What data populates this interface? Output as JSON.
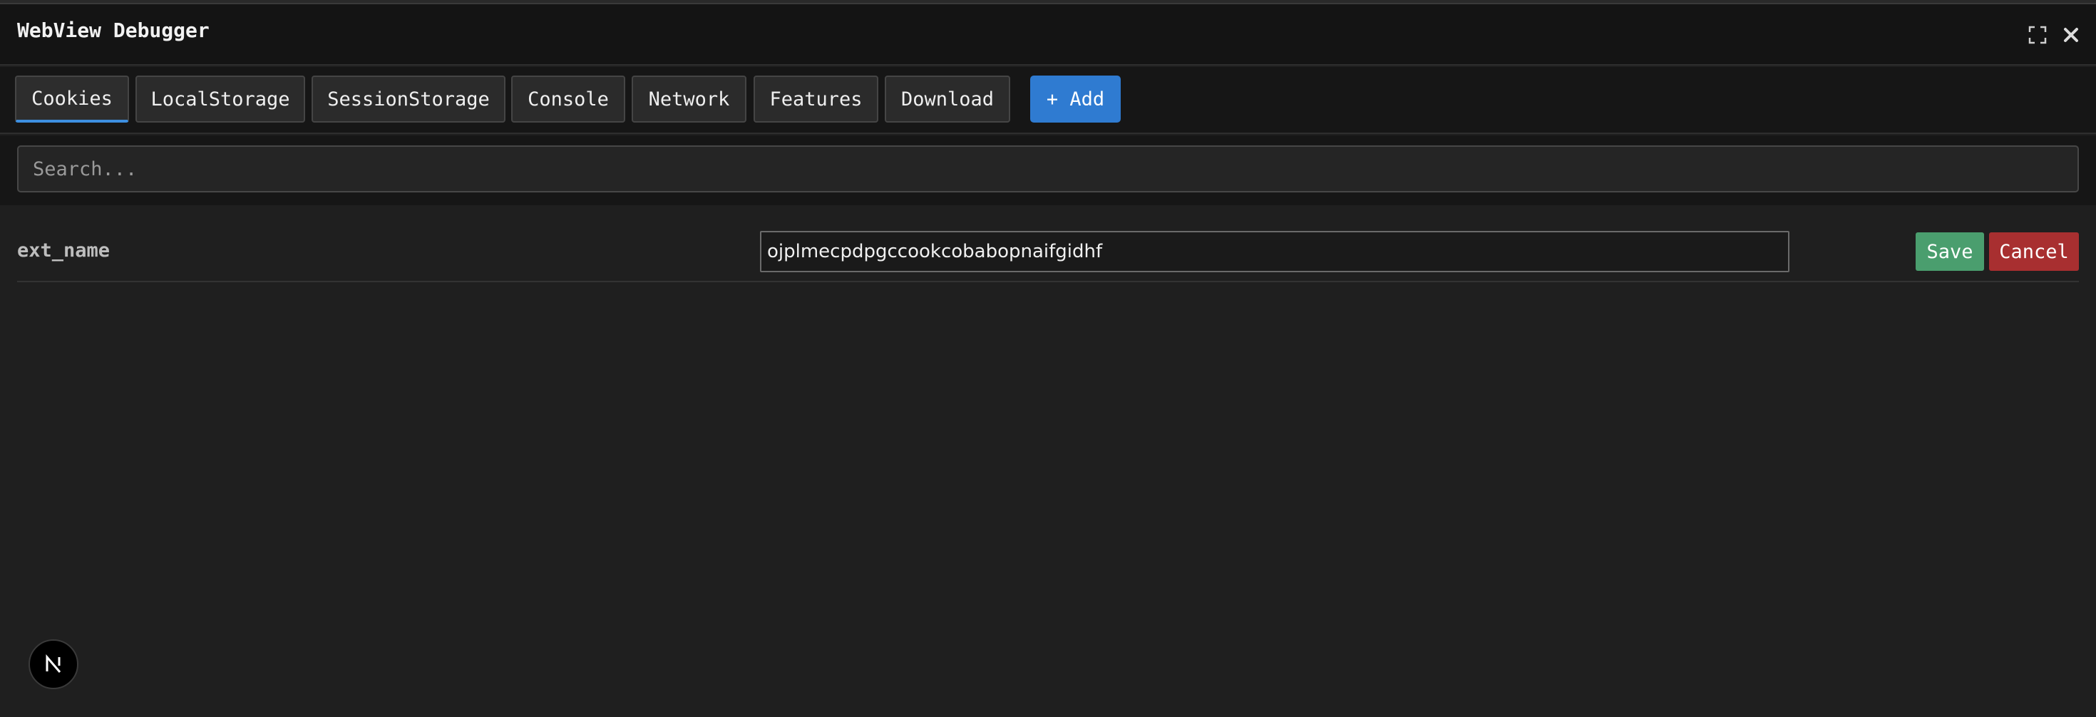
{
  "window": {
    "title": "WebView Debugger",
    "expand_icon": "expand-icon",
    "close_icon": "close-icon"
  },
  "tabs": [
    {
      "label": "Cookies",
      "active": true
    },
    {
      "label": "LocalStorage",
      "active": false
    },
    {
      "label": "SessionStorage",
      "active": false
    },
    {
      "label": "Console",
      "active": false
    },
    {
      "label": "Network",
      "active": false
    },
    {
      "label": "Features",
      "active": false
    },
    {
      "label": "Download",
      "active": false
    }
  ],
  "add_button": {
    "label": "+ Add"
  },
  "search": {
    "placeholder": "Search...",
    "value": ""
  },
  "cookies": [
    {
      "key": "ext_name",
      "value": "ojplmecpdpgccookcobabopnaifgidhf"
    }
  ],
  "row_actions": {
    "save_label": "Save",
    "cancel_label": "Cancel"
  },
  "fab": {
    "icon": "next-logo-icon",
    "letter": "N"
  },
  "colors": {
    "accent": "#3d8fe0",
    "add": "#2f7bd1",
    "save": "#4a9e6e",
    "cancel": "#a82f30"
  }
}
